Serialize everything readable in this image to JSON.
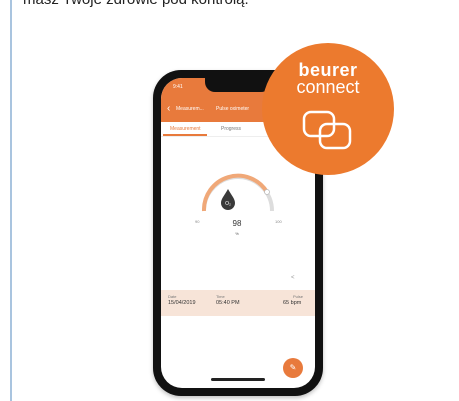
{
  "headline": {
    "text": "masz Twoje zdrowie pod kontrolą."
  },
  "phone": {
    "status_time": "9:41",
    "nav": {
      "back_icon": "chevron-left-icon",
      "crumb": "Measurem...",
      "title": "Pulse oximeter"
    },
    "tabs": [
      {
        "label": "Measurement",
        "active": true
      },
      {
        "label": "Progress",
        "active": false
      }
    ],
    "gauge": {
      "value": "98",
      "unit": "%",
      "icon": "o2-drop-icon",
      "icon_text": "O₂",
      "min_label": "90",
      "max_label": "100"
    },
    "details": [
      {
        "label": "Date",
        "value": "15/04/2019"
      },
      {
        "label": "Time",
        "value": "05:40 PM"
      },
      {
        "label": "Pulse",
        "value": "65 bpm"
      }
    ],
    "fab_icon": "pen-icon",
    "share_icon": "share-icon"
  },
  "brand": {
    "name": "beurer",
    "subtitle": "connect",
    "logo_icon": "beurer-connect-logo"
  },
  "colors": {
    "accent": "#e87a3c",
    "brand_orange": "#ec7a2e",
    "details_bg": "#f7e4d8",
    "rule": "#a9c4df"
  }
}
